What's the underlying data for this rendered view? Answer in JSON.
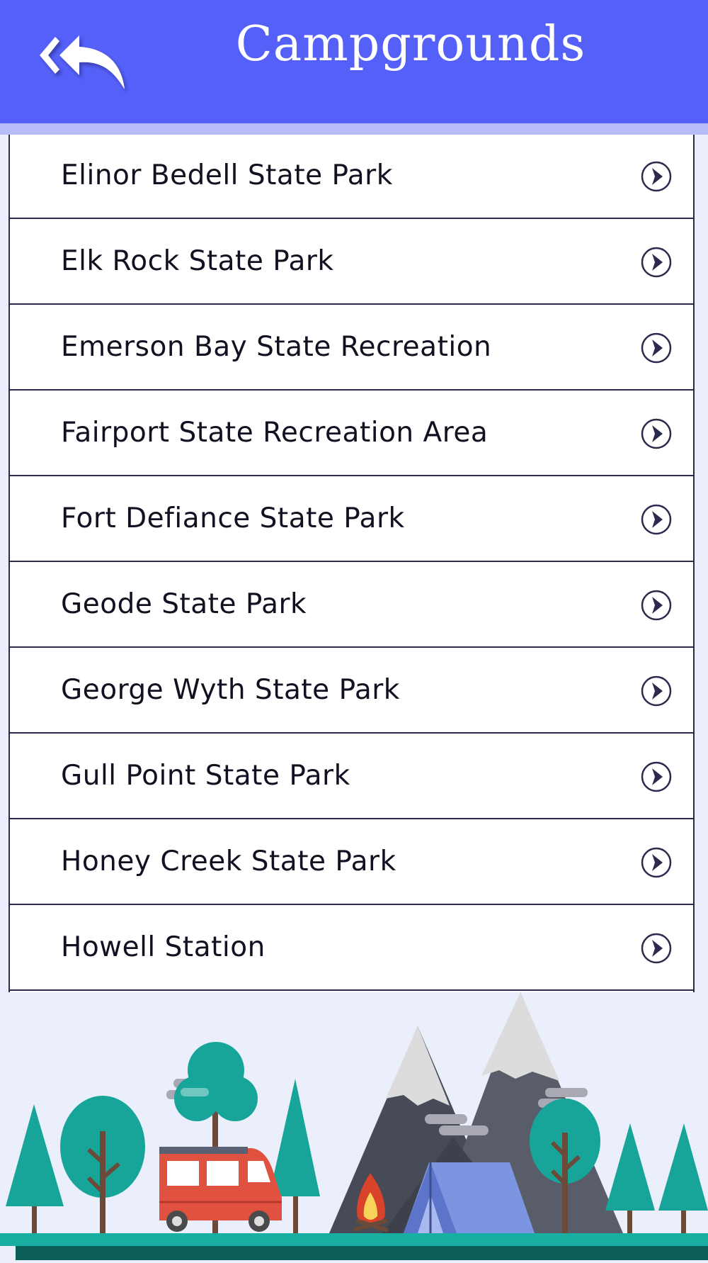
{
  "header": {
    "title": "Campgrounds",
    "back_icon": "double-back-arrow-icon",
    "bg_color": "#5460F7"
  },
  "list": {
    "items": [
      {
        "label": "Elinor Bedell State Park"
      },
      {
        "label": "Elk Rock State Park"
      },
      {
        "label": "Emerson Bay State Recreation"
      },
      {
        "label": "Fairport State Recreation Area"
      },
      {
        "label": "Fort Defiance State Park"
      },
      {
        "label": "Geode State Park"
      },
      {
        "label": "George Wyth State Park"
      },
      {
        "label": "Gull Point State Park"
      },
      {
        "label": "Honey Creek State Park"
      },
      {
        "label": "Howell Station"
      },
      {
        "label": ""
      }
    ],
    "row_icon": "chevron-right-circle-icon"
  },
  "footer": {
    "illustration": "camping-scene-illustration"
  }
}
